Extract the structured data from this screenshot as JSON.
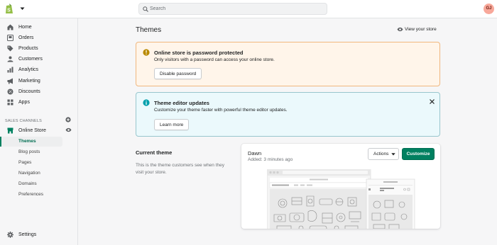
{
  "topbar": {
    "search_placeholder": "Search",
    "avatar_initials": "GJ"
  },
  "sidebar": {
    "items": [
      {
        "label": "Home",
        "icon": "home-icon"
      },
      {
        "label": "Orders",
        "icon": "orders-icon"
      },
      {
        "label": "Products",
        "icon": "tag-icon"
      },
      {
        "label": "Customers",
        "icon": "person-icon"
      },
      {
        "label": "Analytics",
        "icon": "bar-chart-icon"
      },
      {
        "label": "Marketing",
        "icon": "megaphone-icon"
      },
      {
        "label": "Discounts",
        "icon": "discount-icon"
      },
      {
        "label": "Apps",
        "icon": "apps-icon"
      }
    ],
    "sales_channels_label": "SALES CHANNELS",
    "online_store_label": "Online Store",
    "sub_items": [
      {
        "label": "Themes",
        "active": true
      },
      {
        "label": "Blog posts",
        "active": false
      },
      {
        "label": "Pages",
        "active": false
      },
      {
        "label": "Navigation",
        "active": false
      },
      {
        "label": "Domains",
        "active": false
      },
      {
        "label": "Preferences",
        "active": false
      }
    ],
    "settings_label": "Settings"
  },
  "main": {
    "title": "Themes",
    "view_store_label": "View your store",
    "password_banner": {
      "title": "Online store is password protected",
      "text": "Only visitors with a password can access your online store.",
      "button": "Disable password"
    },
    "editor_banner": {
      "title": "Theme editor updates",
      "text": "Customize your theme faster with powerful theme editor updates.",
      "button": "Learn more"
    },
    "current_theme": {
      "heading": "Current theme",
      "description": "This is the theme customers see when they visit your store.",
      "name": "Dawn",
      "added": "Added: 3 minutes ago",
      "actions_label": "Actions",
      "customize_label": "Customize"
    }
  },
  "colors": {
    "accent": "#008060",
    "warning_bg": "#fff5ea",
    "warning_border": "#f0b77e",
    "info_bg": "#ebf9fc",
    "info_border": "#98c6cd"
  }
}
